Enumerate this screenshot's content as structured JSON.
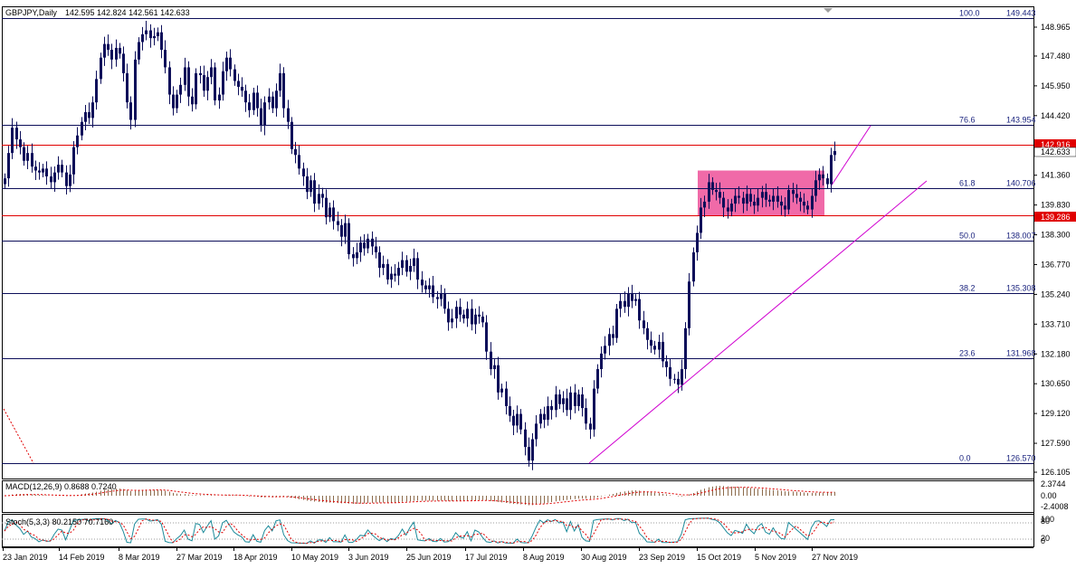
{
  "header": {
    "symbol": "GBPJPY,Daily",
    "ohlc": "142.595 142.824 142.561 142.633"
  },
  "price_axis": {
    "labels": [
      "148.965",
      "147.480",
      "145.950",
      "144.420",
      "141.360",
      "139.830",
      "138.300",
      "136.770",
      "135.240",
      "133.710",
      "132.180",
      "130.650",
      "129.120",
      "127.590",
      "126.105"
    ],
    "current_high_tag": "142.916",
    "current_price_tag": "142.633",
    "resistance_tag": "139.286"
  },
  "fib_levels": [
    {
      "pct": "100.0",
      "price": "149.443"
    },
    {
      "pct": "76.6",
      "price": "143.954"
    },
    {
      "pct": "61.8",
      "price": "140.706"
    },
    {
      "pct": "50.0",
      "price": "138.007"
    },
    {
      "pct": "38.2",
      "price": "135.308"
    },
    {
      "pct": "23.6",
      "price": "131.968"
    },
    {
      "pct": "0.0",
      "price": "126.570"
    }
  ],
  "macd": {
    "label": "MACD(12,26,9) 0.8688 0.7240",
    "axis": [
      "2.3744",
      "0.00",
      "-2.4008"
    ]
  },
  "stoch": {
    "label": "Stoch(5,3,3) 80.2150 70.7160",
    "axis": [
      "100",
      "80",
      "20",
      "0"
    ]
  },
  "time_axis": [
    "23 Jan 2019",
    "14 Feb 2019",
    "8 Mar 2019",
    "27 Mar 2019",
    "18 Apr 2019",
    "10 May 2019",
    "3 Jun 2019",
    "25 Jun 2019",
    "17 Jul 2019",
    "8 Aug 2019",
    "30 Aug 2019",
    "23 Sep 2019",
    "15 Oct 2019",
    "5 Nov 2019",
    "27 Nov 2019"
  ],
  "colors": {
    "candle": "#0d0f5a",
    "fib_line": "#0d0f5a",
    "horizontal_line": "#e00000",
    "trendline": "#d000d0",
    "zone": "#f06aa8",
    "macd_hist": "#8b6a4a",
    "macd_signal": "#e00000",
    "stoch_main": "#1b8a9a",
    "stoch_signal": "#e00000"
  },
  "chart_data": {
    "type": "candlestick",
    "title": "GBPJPY,Daily",
    "ylim": [
      126.105,
      149.443
    ],
    "close": [
      141.2,
      142.5,
      143.8,
      143.2,
      142.8,
      142.1,
      142.5,
      141.8,
      141.6,
      141.5,
      141.7,
      141.3,
      141.0,
      141.5,
      141.9,
      141.5,
      140.8,
      141.4,
      142.8,
      143.4,
      144.1,
      144.6,
      144.3,
      145.1,
      146.3,
      147.4,
      148.1,
      147.8,
      147.3,
      147.9,
      147.6,
      146.6,
      145.1,
      144.2,
      147.3,
      148.2,
      148.6,
      148.8,
      148.4,
      148.5,
      148.7,
      147.8,
      146.9,
      145.5,
      144.8,
      145.5,
      146.0,
      146.9,
      145.4,
      145.0,
      146.6,
      146.5,
      145.7,
      146.4,
      146.9,
      145.2,
      145.5,
      146.7,
      147.4,
      146.8,
      146.2,
      145.9,
      145.7,
      145.1,
      144.7,
      145.6,
      144.8,
      143.9,
      145.1,
      145.4,
      144.8,
      145.7,
      146.6,
      144.8,
      144.1,
      142.7,
      142.4,
      141.7,
      141.3,
      140.5,
      141.1,
      139.9,
      140.4,
      140.2,
      139.2,
      139.7,
      139.0,
      138.8,
      138.2,
      138.9,
      137.3,
      137.1,
      137.4,
      137.9,
      137.6,
      138.1,
      137.7,
      137.4,
      136.6,
      136.8,
      136.0,
      136.3,
      136.2,
      136.6,
      137.0,
      136.4,
      136.7,
      137.1,
      136.0,
      135.7,
      135.5,
      135.7,
      135.1,
      135.0,
      135.3,
      134.5,
      133.8,
      134.0,
      134.6,
      134.2,
      134.0,
      134.5,
      133.7,
      134.2,
      134.1,
      133.8,
      132.3,
      131.4,
      131.6,
      130.2,
      130.4,
      129.5,
      129.0,
      128.5,
      129.1,
      128.3,
      127.4,
      126.7,
      127.8,
      128.6,
      129.1,
      128.8,
      129.5,
      129.3,
      130.1,
      129.6,
      129.9,
      129.3,
      130.2,
      129.5,
      130.1,
      129.4,
      128.6,
      128.3,
      130.4,
      131.4,
      132.2,
      132.6,
      133.2,
      133.0,
      134.5,
      134.9,
      134.6,
      135.3,
      134.9,
      135.0,
      133.9,
      133.5,
      132.9,
      132.6,
      132.4,
      132.8,
      131.8,
      131.5,
      130.9,
      130.9,
      130.6,
      131.4,
      133.5,
      135.9,
      137.4,
      138.4,
      139.7,
      140.0,
      141.0,
      140.6,
      140.5,
      140.2,
      139.7,
      139.5,
      139.9,
      140.3,
      140.2,
      139.9,
      140.4,
      140.0,
      139.8,
      140.2,
      140.5,
      140.1,
      140.0,
      140.3,
      140.0,
      139.8,
      139.6,
      140.6,
      140.4,
      140.2,
      140.0,
      139.8,
      139.6,
      140.3,
      141.1,
      141.4,
      141.2,
      140.9,
      142.4,
      142.6
    ]
  }
}
